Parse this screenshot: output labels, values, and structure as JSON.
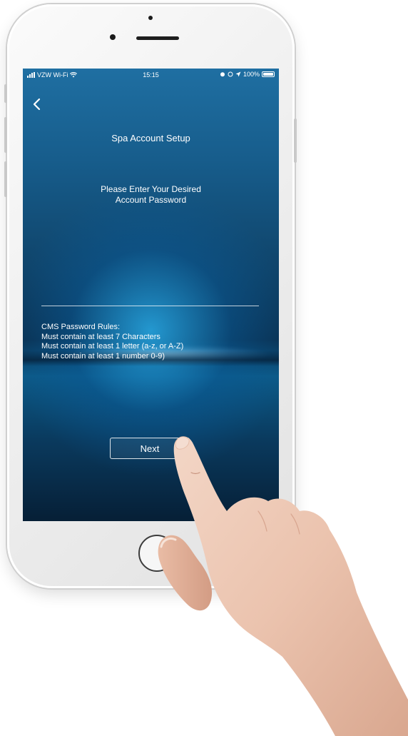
{
  "status_bar": {
    "carrier": "VZW Wi-Fi",
    "time": "15:15",
    "battery": "100%"
  },
  "header": {
    "back_icon": "chevron-left-icon",
    "title": "Spa Account Setup"
  },
  "prompt": {
    "line1": "Please Enter Your Desired",
    "line2": "Account Password"
  },
  "password_field": {
    "value": "",
    "placeholder": ""
  },
  "rules": {
    "heading": "CMS Password Rules:",
    "items": [
      "Must contain at least 7 Characters",
      "Must contain at least 1 letter (a-z, or A-Z)",
      "Must contain at least 1 number 0-9)"
    ]
  },
  "actions": {
    "next_label": "Next"
  },
  "colors": {
    "screen_top": "#1f6fa2",
    "screen_bottom": "#061f36",
    "text": "#ffffff"
  }
}
